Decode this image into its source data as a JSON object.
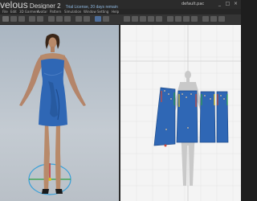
{
  "app": {
    "brand": "velous",
    "product": " Designer 2",
    "license": "Trial License, 20 days remain",
    "filename": "default.pac"
  },
  "window_controls": [
    "_",
    "□",
    "×"
  ],
  "menu": [
    "File",
    "Edit",
    "3D Garment",
    "Avatar",
    "Pattern",
    "Simulation",
    "Window",
    "Setting",
    "Help"
  ],
  "colors": {
    "garment": "#2f67b5",
    "skin": "#b88a6a",
    "viewport_3d_bg": "#b8c2cc",
    "viewport_2d_bg": "#f4f4f4"
  }
}
